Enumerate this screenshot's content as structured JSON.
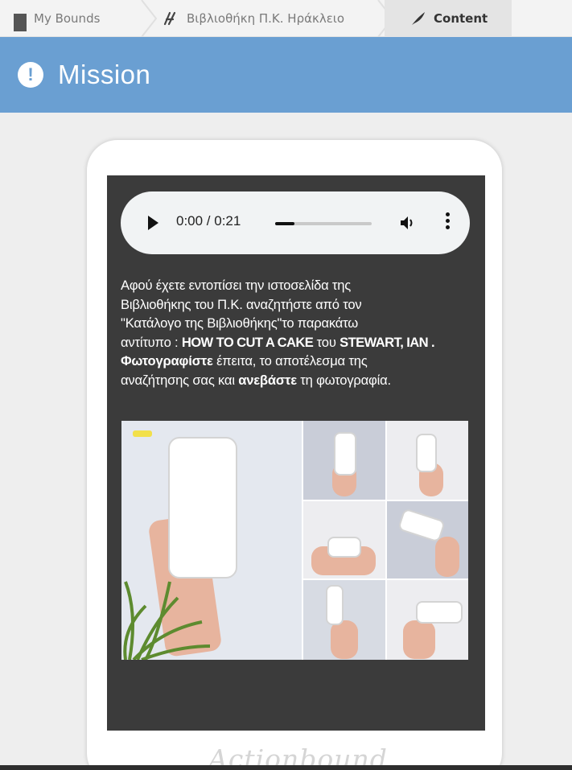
{
  "breadcrumb": {
    "items": [
      {
        "label": "My Bounds",
        "icon": "grid-icon"
      },
      {
        "label": "Βιβλιοθήκη Π.Κ. Ηράκλειο",
        "icon": "route-icon"
      },
      {
        "label": "Content",
        "icon": "feather-icon"
      }
    ]
  },
  "mission": {
    "title": "Mission",
    "icon": "alert-icon",
    "color": "#6a9fd2"
  },
  "audio": {
    "time": "0:00 / 0:21",
    "progress": 0.2
  },
  "content": {
    "line1": "Αφού έχετε εντοπίσει την ιστοσελίδα της",
    "line2": "Βιβλιοθήκης του Π.Κ. αναζητήστε από τον",
    "line3": "\"Κατάλογο της Βιβλιοθήκης\"το παρακάτω",
    "line4a": "αντίτυπο : ",
    "line4b": "HOW TO CUT A CAKE",
    "line4c": " του ",
    "line4d": "STEWART, IAN .",
    "line5a": "Φωτογραφίστε",
    "line5b": " έπειτα, το αποτέλεσμα της",
    "line6a": "αναζήτησης σας και ",
    "line6b": "ανεβάστε",
    "line6c": " τη φωτογραφία."
  },
  "footer": {
    "watermark": "Actionbound"
  }
}
